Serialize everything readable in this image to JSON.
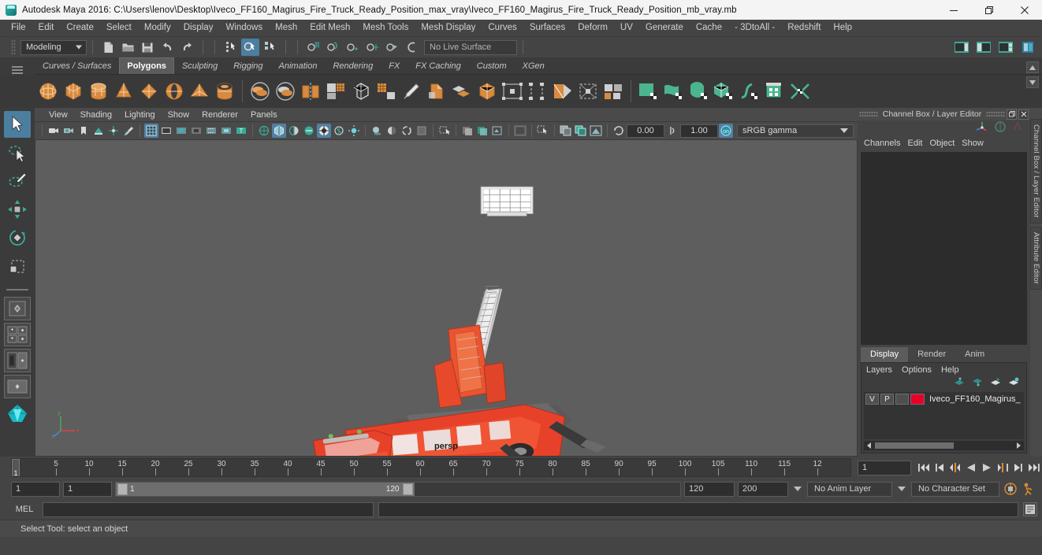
{
  "window": {
    "title": "Autodesk Maya 2016: C:\\Users\\lenov\\Desktop\\Iveco_FF160_Magirus_Fire_Truck_Ready_Position_max_vray\\Iveco_FF160_Magirus_Fire_Truck_Ready_Position_mb_vray.mb",
    "logo": "maya-logo-icon",
    "minimize": "minimize-icon",
    "restore": "restore-icon",
    "close": "close-icon"
  },
  "menubar": {
    "items": [
      "File",
      "Edit",
      "Create",
      "Select",
      "Modify",
      "Display",
      "Windows",
      "Mesh",
      "Edit Mesh",
      "Mesh Tools",
      "Mesh Display",
      "Curves",
      "Surfaces",
      "Deform",
      "UV",
      "Generate",
      "Cache",
      "- 3DtoAll -",
      "Redshift",
      "Help"
    ]
  },
  "statusline": {
    "mode": "Modeling",
    "live_surface": "No Live Surface",
    "file_icons": [
      "new-scene-icon",
      "open-scene-icon",
      "save-scene-icon",
      "undo-icon",
      "redo-icon"
    ],
    "select_mask_icons": [
      "select-by-hierarchy-icon",
      "select-by-object-type-icon",
      "select-by-component-type-icon"
    ],
    "snap_icons": [
      "snap-to-grid-icon",
      "snap-to-curve-icon",
      "snap-to-point-icon",
      "snap-to-projected-center-icon",
      "snap-to-view-plane-icon",
      "make-live-icon"
    ],
    "right_icons": [
      "show-hide-attribute-editor-icon",
      "show-hide-tool-settings-icon",
      "show-hide-channel-box-icon",
      "sidebar-toggle-icon"
    ]
  },
  "shelf": {
    "tabs": [
      "Curves / Surfaces",
      "Polygons",
      "Sculpting",
      "Rigging",
      "Animation",
      "Rendering",
      "FX",
      "FX Caching",
      "Custom",
      "XGen"
    ],
    "selected_tab": "Polygons",
    "icons": [
      "poly-sphere-icon",
      "poly-cube-icon",
      "poly-cylinder-icon",
      "poly-cone-icon",
      "poly-plane-icon",
      "poly-torus-icon",
      "poly-pyramid-icon",
      "poly-pipe-icon",
      "poly-boolean-union-icon",
      "poly-boolean-difference-icon",
      "poly-combine-icon",
      "poly-smooth-icon",
      "poly-extrude-icon",
      "poly-bevel-icon",
      "poly-sculpt-icon",
      "poly-multi-cut-icon",
      "poly-target-weld-icon",
      "poly-quad-draw-icon",
      "poly-mirror-icon",
      "poly-insert-edge-loop-icon",
      "poly-offset-edge-loop-icon",
      "poly-bridge-icon",
      "poly-append-icon",
      "uv-editor-icon",
      "uv-planar-icon",
      "uv-cylindrical-icon",
      "uv-automatic-icon",
      "uv-unfold-icon",
      "uv-layout-icon",
      "uv-cut-sew-icon"
    ]
  },
  "toolbox": {
    "tools": [
      {
        "name": "select-tool-icon",
        "selected": true
      },
      {
        "name": "lasso-select-tool-icon",
        "selected": false
      },
      {
        "name": "paint-select-tool-icon",
        "selected": false
      },
      {
        "name": "move-tool-icon",
        "selected": false
      },
      {
        "name": "rotate-tool-icon",
        "selected": false
      },
      {
        "name": "scale-tool-icon",
        "selected": false
      }
    ],
    "quick_layouts": [
      "single-perspective-view-icon",
      "four-view-layout-icon",
      "persp-outliner-layout-icon",
      "persp-graph-editor-layout-icon",
      "persp-hypershade-layout-icon"
    ]
  },
  "viewport": {
    "menus": [
      "View",
      "Shading",
      "Lighting",
      "Show",
      "Renderer",
      "Panels"
    ],
    "toolbar_icons": [
      "select-camera-icon",
      "camera-attributes-icon",
      "bookmarks-icon",
      "image-plane-icon",
      "two-d-pan-zoom-icon",
      "grease-pencil-icon",
      "grid-toggle-icon",
      "film-gate-icon",
      "resolution-gate-icon",
      "gate-mask-icon",
      "film-origin-icon",
      "exposure-icon",
      "safe-title-icon",
      "wireframe-shading-icon",
      "smooth-shade-all-icon",
      "smooth-shade-selected-icon",
      "flat-shade-icon",
      "wireframe-on-shaded-icon",
      "texture-icon",
      "lighting-icon",
      "shadows-icon",
      "screen-space-ao-icon",
      "motion-blur-icon",
      "multisample-icon",
      "isolate-select-icon",
      "xray-icon",
      "xray-joints-icon",
      "xray-active-components-icon"
    ],
    "exposure_value": "0.00",
    "gamma_value": "1.00",
    "color_profile": "sRGB gamma",
    "camera_label": "persp"
  },
  "channelbox": {
    "panel_title": "Channel Box / Layer Editor",
    "menus": [
      "Channels",
      "Edit",
      "Object",
      "Show"
    ],
    "icon_buttons": [
      "manipulator-icon",
      "channel-box-icon",
      "attribute-editor-icon"
    ],
    "dock_tabs": [
      "Channel Box / Layer Editor",
      "Attribute Editor"
    ],
    "undock": "undock-icon",
    "close": "close-panel-icon"
  },
  "layereditor": {
    "tabs": [
      "Display",
      "Render",
      "Anim"
    ],
    "selected_tab": "Display",
    "menus": [
      "Layers",
      "Options",
      "Help"
    ],
    "buttons": [
      "move-layer-up-icon",
      "move-layer-down-icon",
      "new-layer-icon",
      "new-layer-from-selected-icon"
    ],
    "layers": [
      {
        "visibility": "V",
        "playback": "P",
        "shading": "",
        "color": "#e8002a",
        "name": "Iveco_FF160_Magirus_"
      }
    ]
  },
  "timeslider": {
    "current_frame": "1",
    "tick_labels": [
      "5",
      "10",
      "15",
      "20",
      "25",
      "30",
      "35",
      "40",
      "45",
      "50",
      "55",
      "60",
      "65",
      "70",
      "75",
      "80",
      "85",
      "90",
      "95",
      "100",
      "105",
      "110",
      "115",
      "12"
    ],
    "start": 1,
    "end": 120,
    "playback_icons": [
      "go-to-start-icon",
      "step-back-keyframe-icon",
      "step-back-frame-icon",
      "play-backwards-icon",
      "play-forwards-icon",
      "step-forward-frame-icon",
      "step-forward-keyframe-icon",
      "go-to-end-icon"
    ]
  },
  "rangeslider": {
    "anim_start": "1",
    "range_start": "1",
    "bar_start_label": "1",
    "bar_end_label": "120",
    "range_end": "120",
    "anim_end": "200",
    "anim_layer": "No Anim Layer",
    "character_set": "No Character Set",
    "auto_key": "auto-keyframe-icon",
    "anim_prefs": "animation-preferences-icon"
  },
  "commandline": {
    "language": "MEL",
    "input_value": "",
    "output_value": "",
    "script_editor_button": "script-editor-icon"
  },
  "helpline": {
    "message": "Select Tool: select an object"
  },
  "colors": {
    "accent_blue": "#4c7ea0",
    "shelf_orange": "#d88b3f",
    "shelf_green": "#4bb58e",
    "teal": "#3aa99a",
    "layer_red": "#e8002a",
    "viewport_bg": "#5e5e5e",
    "truck_body": "#e8412a"
  }
}
